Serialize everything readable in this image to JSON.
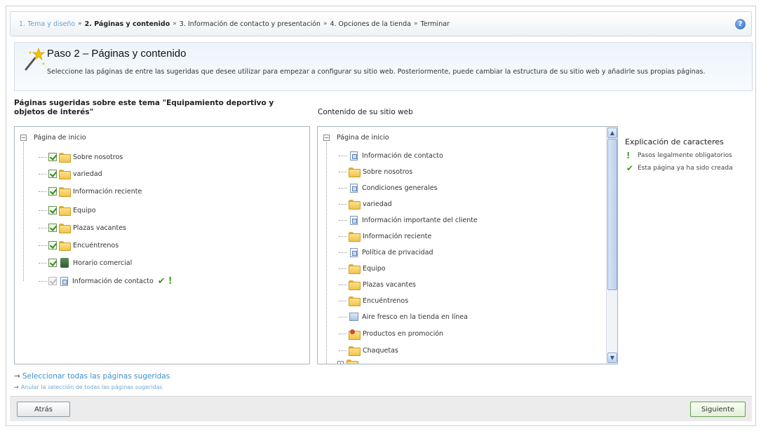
{
  "breadcrumb": {
    "step1": "1. Tema y diseño",
    "step2": "2. Páginas y contenido",
    "step3": "3. Información de contacto y presentación",
    "step4": "4. Opciones de la tienda",
    "step5": "Terminar",
    "separator": "»"
  },
  "help_icon": "?",
  "step": {
    "title": "Paso 2 – Páginas y contenido",
    "description": "Seleccione las páginas de entre las sugeridas que desee utilizar para empezar a configurar su sitio web. Posteriormente, puede cambiar la estructura de su sitio web y añadirle sus propias páginas."
  },
  "left": {
    "title": "Páginas sugeridas sobre este tema \"Equipamiento deportivo y objetos de interés\"",
    "root": "Página de inicio",
    "items": [
      {
        "label": "Sobre nosotros",
        "icon": "folder-icon",
        "checked": true
      },
      {
        "label": "variedad",
        "icon": "folder-icon",
        "checked": true
      },
      {
        "label": "Información reciente",
        "icon": "folder-icon",
        "checked": true
      },
      {
        "label": "Equipo",
        "icon": "folder-icon",
        "checked": true
      },
      {
        "label": "Plazas vacantes",
        "icon": "folder-icon",
        "checked": true
      },
      {
        "label": "Encuéntrenos",
        "icon": "folder-icon",
        "checked": true
      },
      {
        "label": "Horario comercial",
        "icon": "clock-icon",
        "checked": true
      },
      {
        "label": "Información de contacto",
        "icon": "page-icon",
        "checked": true,
        "disabled": true
      }
    ]
  },
  "right": {
    "title": "Contenido de su sitio web",
    "root": "Página de inicio",
    "items": [
      {
        "label": "Información de contacto",
        "icon": "page-icon"
      },
      {
        "label": "Sobre nosotros",
        "icon": "folder-icon"
      },
      {
        "label": "Condiciones generales",
        "icon": "page-icon"
      },
      {
        "label": "variedad",
        "icon": "folder-icon"
      },
      {
        "label": "Información importante del cliente",
        "icon": "page-icon"
      },
      {
        "label": "Información reciente",
        "icon": "folder-icon"
      },
      {
        "label": "Política de privacidad",
        "icon": "page-icon"
      },
      {
        "label": "Equipo",
        "icon": "folder-icon"
      },
      {
        "label": "Plazas vacantes",
        "icon": "folder-icon"
      },
      {
        "label": "Encuéntrenos",
        "icon": "folder-icon"
      },
      {
        "label": "Aire fresco en la tienda en línea",
        "icon": "img-page-icon"
      },
      {
        "label": "Productos en promoción",
        "icon": "promo-icon"
      },
      {
        "label": "Chaquetas",
        "icon": "folder-icon"
      }
    ]
  },
  "legend": {
    "title": "Explicación de caracteres",
    "mandatory": "Pasos legalmente obligatorios",
    "created": "Esta página ya ha sido creada"
  },
  "links": {
    "select_all": "Seleccionar todas las páginas sugeridas",
    "deselect_all": "Anular la selección de todas las páginas sugeridas"
  },
  "buttons": {
    "back": "Atrás",
    "next": "Siguiente"
  },
  "colors": {
    "accent_link": "#3d8fcf",
    "check_green": "#3e9b1f"
  }
}
